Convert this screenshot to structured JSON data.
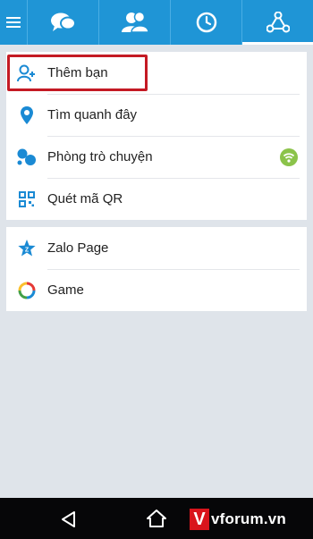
{
  "header": {
    "tabs": [
      {
        "icon": "chat-bubbles-icon",
        "active": false
      },
      {
        "icon": "contacts-icon",
        "active": false
      },
      {
        "icon": "clock-icon",
        "active": false
      },
      {
        "icon": "share-network-icon",
        "active": true
      }
    ],
    "menu_icon": "hamburger-menu-icon"
  },
  "more_menu": {
    "group1": [
      {
        "label": "Thêm bạn",
        "icon": "add-friend-icon"
      },
      {
        "label": "Tìm quanh đây",
        "icon": "location-pin-icon"
      },
      {
        "label": "Phòng trò chuyện",
        "icon": "chat-room-icon",
        "trailing_icon": "wifi-signal-icon"
      },
      {
        "label": "Quét mã QR",
        "icon": "qr-code-icon"
      }
    ],
    "group2": [
      {
        "label": "Zalo Page",
        "icon": "zalo-page-star-icon"
      },
      {
        "label": "Game",
        "icon": "game-icon"
      }
    ]
  },
  "navbar": {
    "watermark_mark": "V",
    "watermark_text": "vforum.vn"
  },
  "colors": {
    "header": "#1f95d6",
    "accent": "#1a8ad4",
    "highlight_border": "#c41a24",
    "wifi_badge": "#8bc34a",
    "background": "#dfe4ea"
  }
}
